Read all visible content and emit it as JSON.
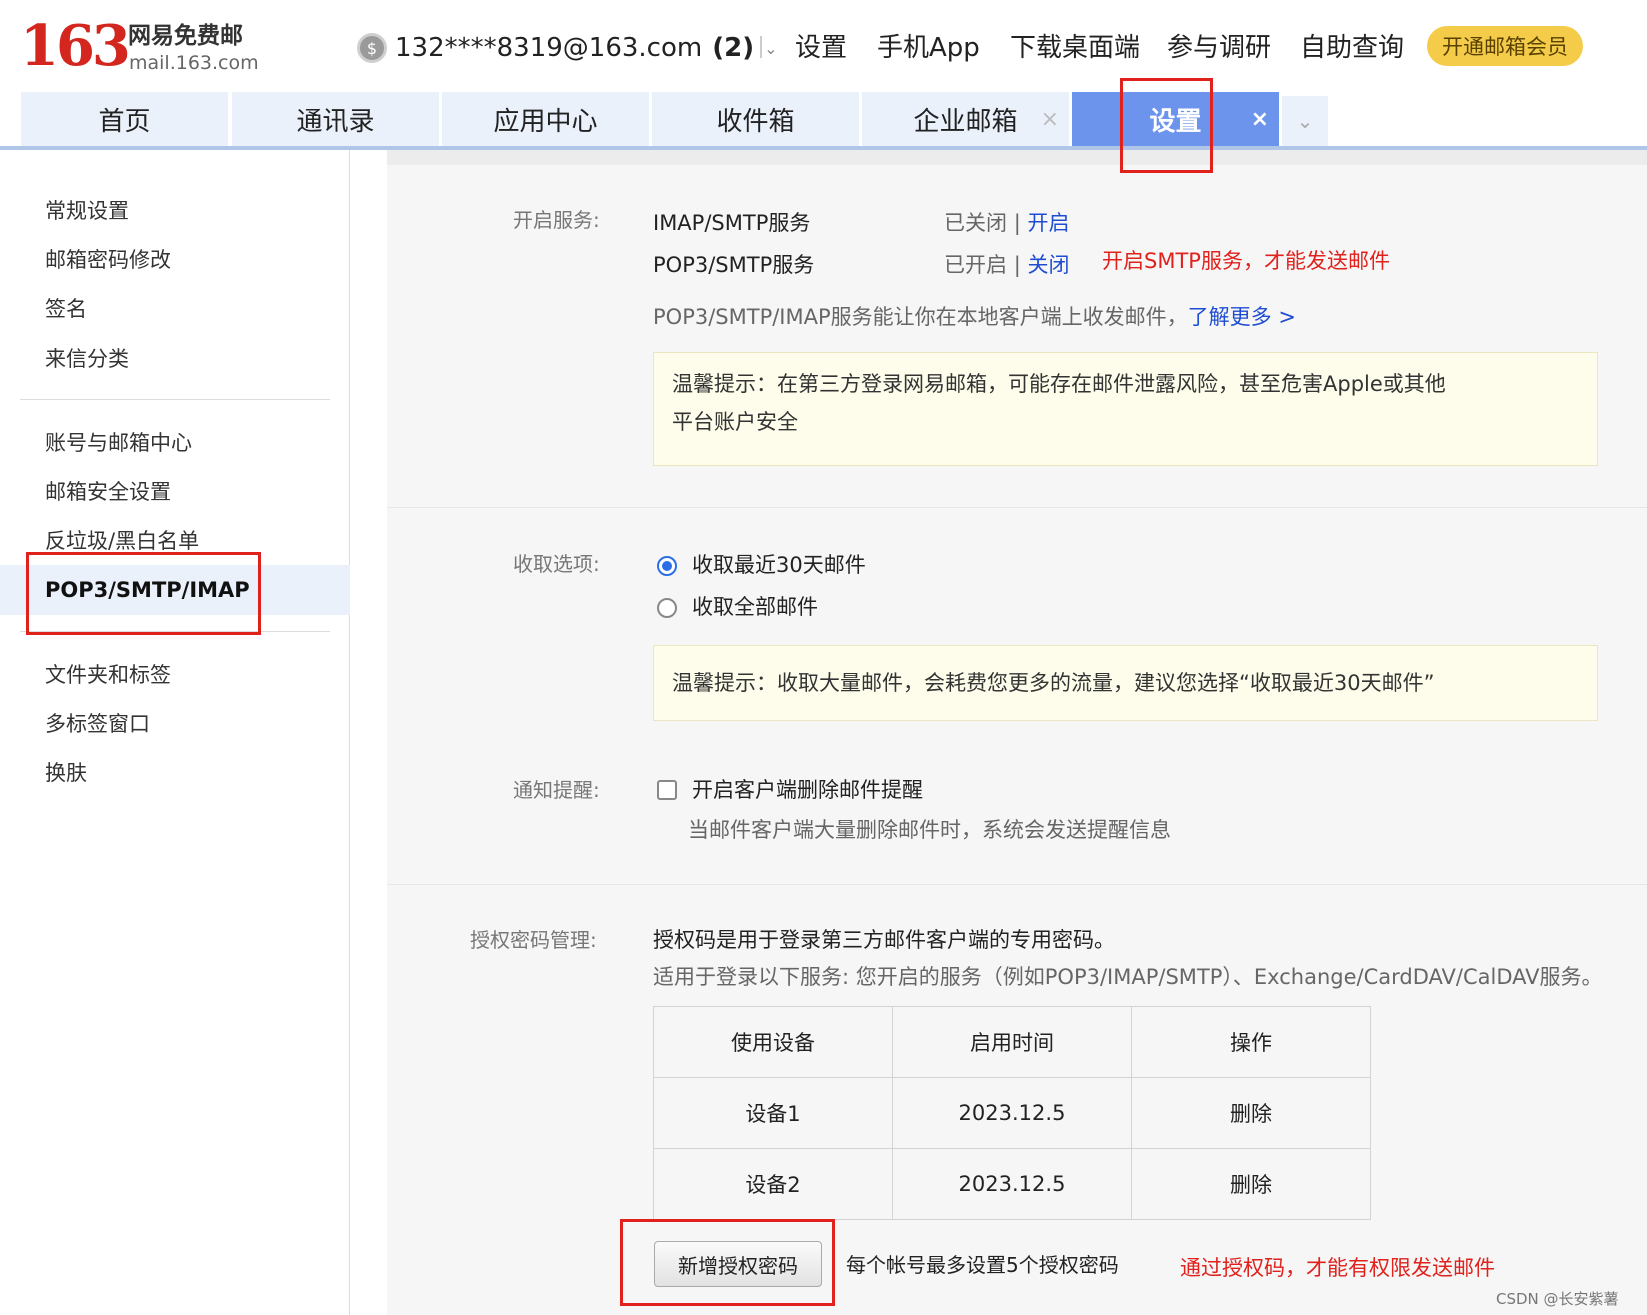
{
  "logo": {
    "number": "163",
    "name_cn": "网易免费邮",
    "domain": "mail.163.com"
  },
  "account": {
    "icon": "coin-icon",
    "email": "132****8319@163.com",
    "count": "(2)",
    "chevron": "⌄"
  },
  "top_links": [
    "设置",
    "手机App",
    "下载桌面端",
    "参与调研",
    "自助查询"
  ],
  "vip_button": "开通邮箱会员",
  "tabs": [
    {
      "label": "首页"
    },
    {
      "label": "通讯录"
    },
    {
      "label": "应用中心"
    },
    {
      "label": "收件箱"
    },
    {
      "label": "企业邮箱",
      "close": "×"
    },
    {
      "label": "设置",
      "close": "×",
      "active": true
    }
  ],
  "tab_more": "⌄",
  "sidebar": {
    "group1": [
      "常规设置",
      "邮箱密码修改",
      "签名",
      "来信分类"
    ],
    "group2": [
      "账号与邮箱中心",
      "邮箱安全设置",
      "反垃圾/黑白名单",
      "POP3/SMTP/IMAP"
    ],
    "group3": [
      "文件夹和标签",
      "多标签窗口",
      "换肤"
    ],
    "active": "POP3/SMTP/IMAP"
  },
  "services": {
    "label": "开启服务:",
    "rows": [
      {
        "name": "IMAP/SMTP服务",
        "status": "已关闭",
        "sep": "|",
        "action": "开启"
      },
      {
        "name": "POP3/SMTP服务",
        "status": "已开启",
        "sep": "|",
        "action": "关闭"
      }
    ],
    "annotation": "开启SMTP服务，才能发送邮件",
    "desc": "POP3/SMTP/IMAP服务能让你在本地客户端上收发邮件，",
    "learn_more": "了解更多 >",
    "tip": [
      "温馨提示：在第三方登录网易邮箱，可能存在邮件泄露风险，甚至危害Apple或其他",
      "平台账户安全"
    ]
  },
  "receive": {
    "label": "收取选项:",
    "options": [
      {
        "text": "收取最近30天邮件",
        "selected": true
      },
      {
        "text": "收取全部邮件",
        "selected": false
      }
    ],
    "tip": "温馨提示：收取大量邮件，会耗费您更多的流量，建议您选择“收取最近30天邮件”"
  },
  "notify": {
    "label": "通知提醒:",
    "checkbox": "开启客户端删除邮件提醒",
    "checked": false,
    "desc": "当邮件客户端大量删除邮件时，系统会发送提醒信息"
  },
  "auth": {
    "label": "授权密码管理:",
    "line1": "授权码是用于登录第三方邮件客户端的专用密码。",
    "line2": "适用于登录以下服务: 您开启的服务（例如POP3/IMAP/SMTP）、Exchange/CardDAV/CalDAV服务。",
    "headers": [
      "使用设备",
      "启用时间",
      "操作"
    ],
    "rows": [
      [
        "设备1",
        "2023.12.5",
        "删除"
      ],
      [
        "设备2",
        "2023.12.5",
        "删除"
      ]
    ],
    "add_button": "新增授权密码",
    "limit": "每个帐号最多设置5个授权密码",
    "annotation": "通过授权码，才能有权限发送邮件"
  },
  "watermark": "CSDN @长安紫薯",
  "colors": {
    "brand": "#d3261f",
    "tab_active": "#6c94ed",
    "link": "#1f4dd1",
    "annotation": "#e0211c",
    "vip": "#f4cc4a"
  }
}
